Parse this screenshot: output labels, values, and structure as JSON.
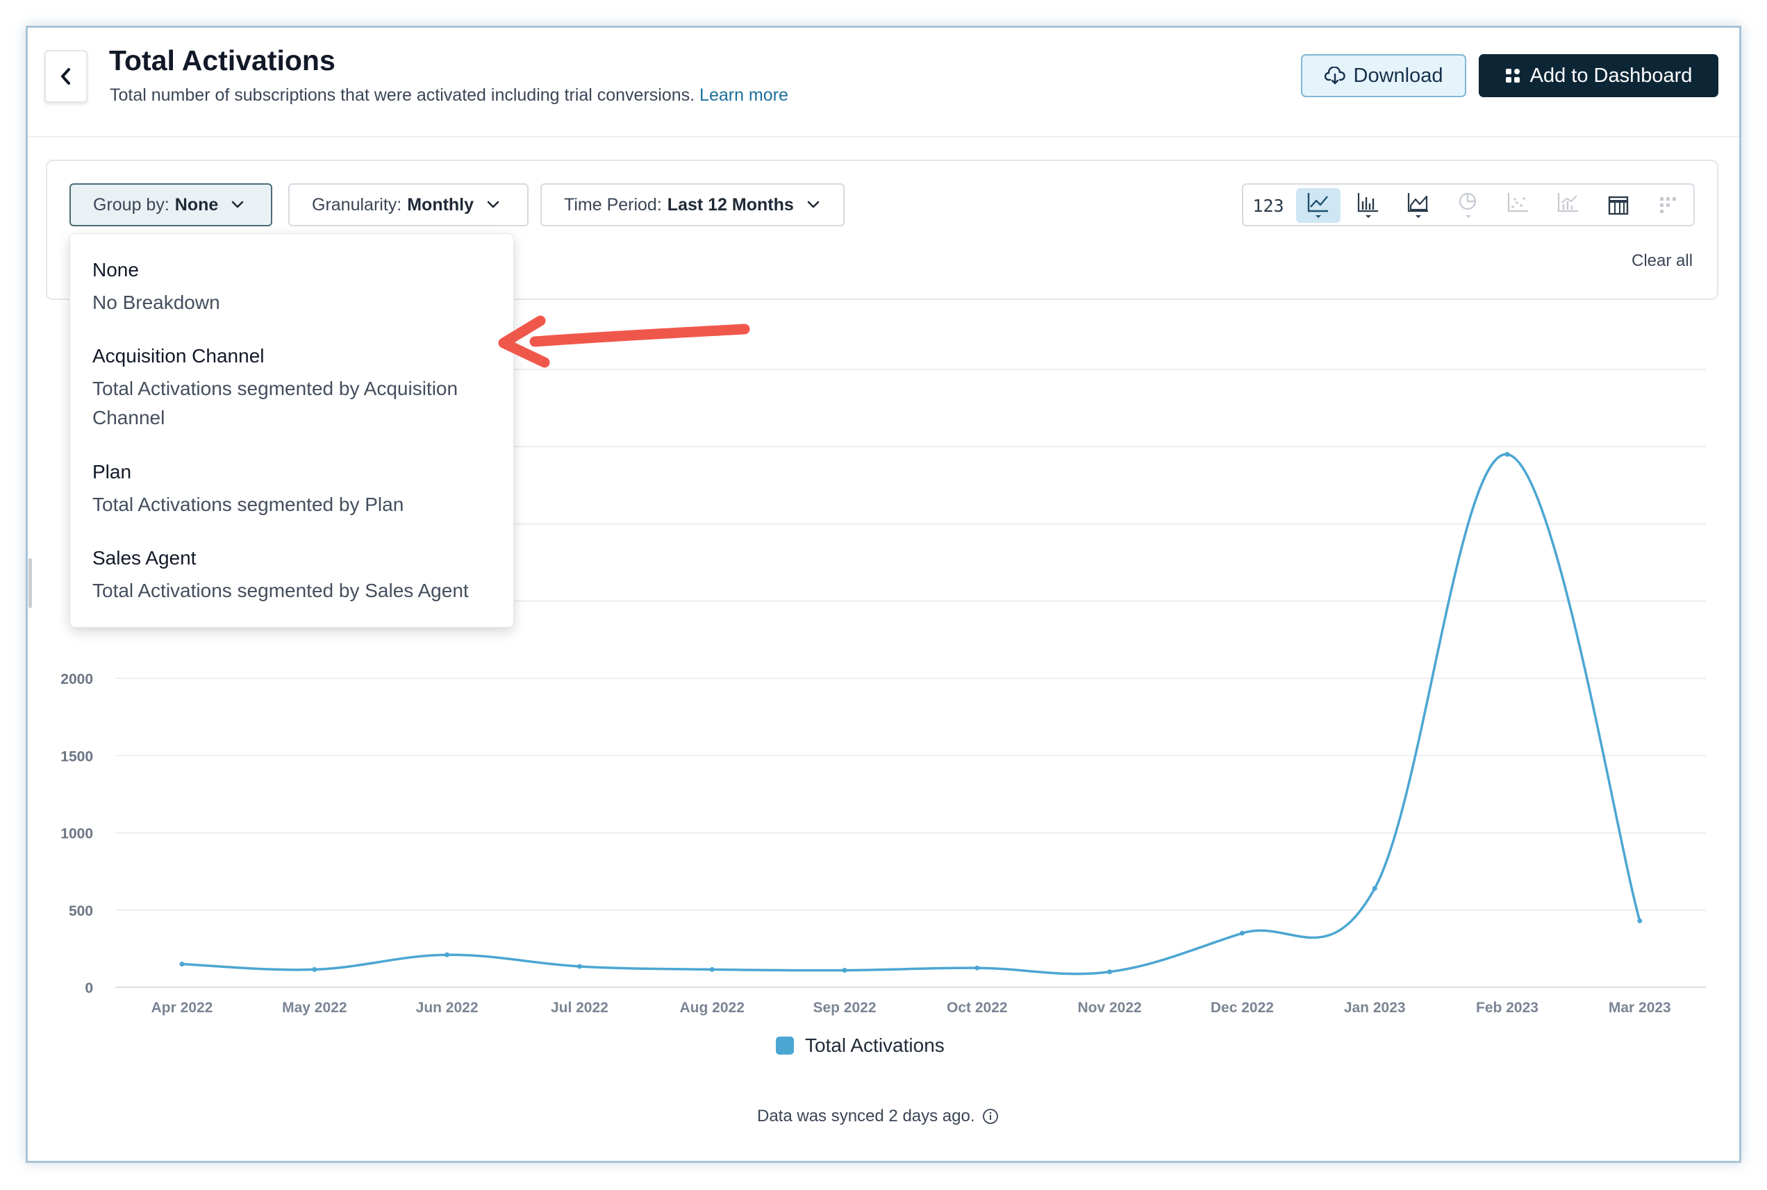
{
  "header": {
    "title": "Total Activations",
    "subtitle": "Total number of subscriptions that were activated including trial conversions.",
    "learn_more": "Learn more",
    "download_label": "Download",
    "add_dashboard_label": "Add to Dashboard"
  },
  "filters": {
    "group_by_label": "Group by:",
    "group_by_value": "None",
    "granularity_label": "Granularity:",
    "granularity_value": "Monthly",
    "time_period_label": "Time Period:",
    "time_period_value": "Last 12 Months",
    "clear_all": "Clear all"
  },
  "chart_type_buttons": [
    {
      "icon": "number-icon",
      "label": "123"
    },
    {
      "icon": "line-chart-icon",
      "selected": true
    },
    {
      "icon": "bar-chart-icon"
    },
    {
      "icon": "area-chart-icon"
    },
    {
      "icon": "pie-chart-icon"
    },
    {
      "icon": "scatter-chart-icon"
    },
    {
      "icon": "combo-chart-icon"
    },
    {
      "icon": "table-icon"
    },
    {
      "icon": "grid-icon"
    }
  ],
  "group_by_dropdown": {
    "options": [
      {
        "title": "None",
        "description": "No Breakdown"
      },
      {
        "title": "Acquisition Channel",
        "description": "Total Activations segmented by Acquisition Channel"
      },
      {
        "title": "Plan",
        "description": "Total Activations segmented by Plan"
      },
      {
        "title": "Sales Agent",
        "description": "Total Activations segmented by Sales Agent"
      }
    ]
  },
  "chart_data": {
    "type": "line",
    "categories": [
      "Apr 2022",
      "May 2022",
      "Jun 2022",
      "Jul 2022",
      "Aug 2022",
      "Sep 2022",
      "Oct 2022",
      "Nov 2022",
      "Dec 2022",
      "Jan 2023",
      "Feb 2023",
      "Mar 2023"
    ],
    "series": [
      {
        "name": "Total Activations",
        "values": [
          150,
          115,
          210,
          135,
          115,
          110,
          125,
          100,
          350,
          640,
          3450,
          430
        ]
      }
    ],
    "y_ticks": [
      "0",
      "500",
      "1000",
      "1500",
      "2000"
    ],
    "ylim": [
      0,
      4000
    ],
    "grid": true,
    "legend": "bottom-center",
    "color": "#4ba6d2"
  },
  "legend_label": "Total Activations",
  "footer": {
    "sync_text": "Data was synced 2 days ago."
  },
  "colors": {
    "accent": "#4ba6d2",
    "primary_button": "#0d2636",
    "annotation_arrow": "#f0574b"
  }
}
